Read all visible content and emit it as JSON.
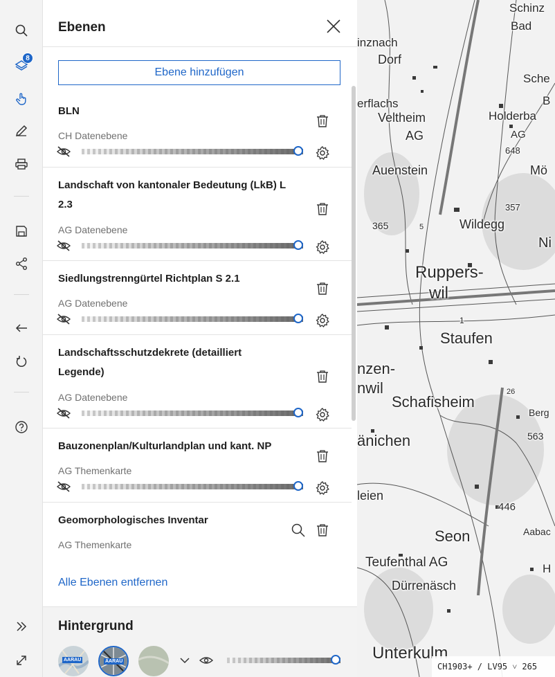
{
  "toolbar": {
    "layers_badge": "8"
  },
  "panel": {
    "title": "Ebenen",
    "add_button": "Ebene hinzufügen",
    "remove_all": "Alle Ebenen entfernen"
  },
  "layers": [
    {
      "title": "BLN",
      "subtitle": "CH Datenebene",
      "opacity": 1.0
    },
    {
      "title": "Landschaft von kantonaler Bedeutung (LkB) L 2.3",
      "subtitle": "AG Datenebene",
      "opacity": 1.0
    },
    {
      "title": "Siedlungstrenngürtel Richtplan S 2.1",
      "subtitle": "AG Datenebene",
      "opacity": 1.0
    },
    {
      "title": "Landschaftsschutzdekrete (detailliert Legende)",
      "subtitle": "AG Datenebene",
      "opacity": 1.0
    },
    {
      "title": "Bauzonenplan/Kulturlandplan und kant. NP",
      "subtitle": "AG Themenkarte",
      "opacity": 1.0
    },
    {
      "title": "Geomorphologisches Inventar",
      "subtitle": "AG Themenkarte",
      "opacity": 1.0
    }
  ],
  "background": {
    "title": "Hintergrund",
    "thumb_label": "AARAU",
    "opacity": 1.0
  },
  "map": {
    "labels": [
      "Schinz",
      "Bad",
      "inznach",
      "Dorf",
      "Sche",
      "erflachs",
      "B",
      "Veltheim",
      "Holderba",
      "AG",
      "AG",
      "648",
      "Auenstein",
      "Mö",
      "357",
      "365",
      "5",
      "Wildegg",
      "Ni",
      "Ruppers-",
      "wil",
      "1",
      "Staufen",
      "nzen-",
      "nwil",
      "Schafisheim",
      "26",
      "Berg",
      "563",
      "änichen",
      "leien",
      "446",
      "Aabac",
      "Seon",
      "Teufenthal AG",
      "H",
      "Dürrenäsch",
      "Unterkulm"
    ],
    "coord_system": "CH1903+ / LV95",
    "coord_value": "265"
  },
  "colors": {
    "accent": "#1e66c8",
    "text": "#1f1f1f",
    "muted": "#707070"
  }
}
